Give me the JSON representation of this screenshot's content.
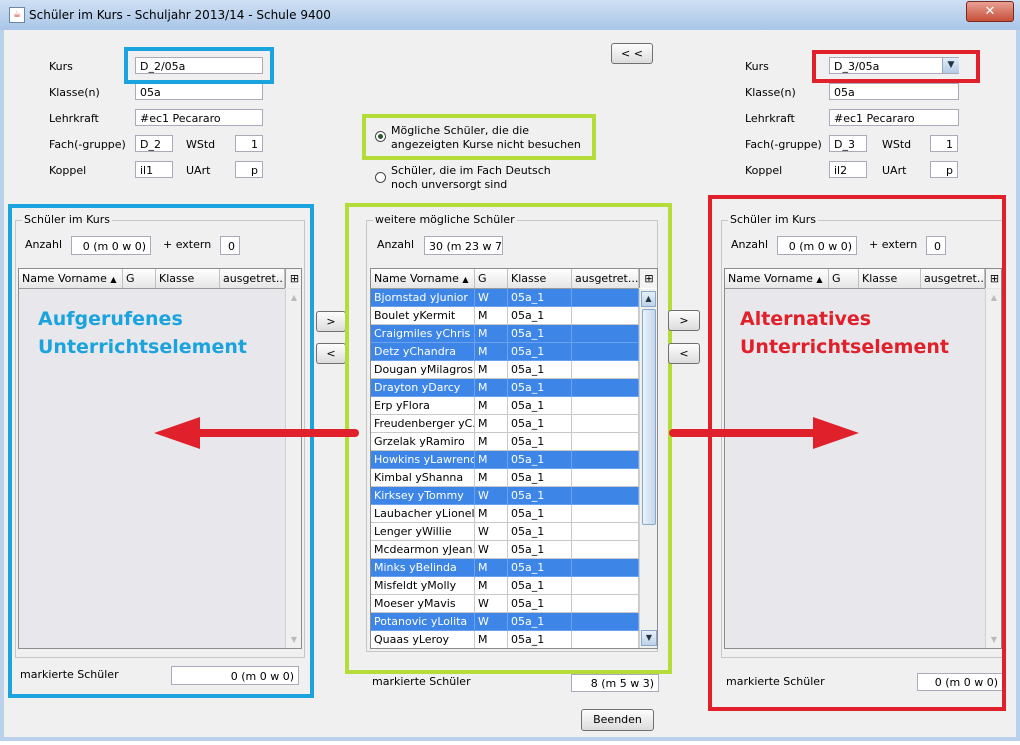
{
  "window": {
    "title": "Schüler im Kurs - Schuljahr 2013/14 - Schule 9400",
    "close_glyph": "✕"
  },
  "labels": {
    "kurs": "Kurs",
    "klassen": "Klasse(n)",
    "lehrkraft": "Lehrkraft",
    "fach": "Fach(-gruppe)",
    "wstd": "WStd",
    "koppel": "Koppel",
    "uart": "UArt",
    "schueler_im_kurs": "Schüler im Kurs",
    "anzahl": "Anzahl",
    "extern": "+  extern",
    "markierte": "markierte Schüler",
    "weitere": "weitere mögliche Schüler"
  },
  "left_course": {
    "kurs": "D_2/05a",
    "klassen": "05a",
    "lehrkraft": "#ec1 Pecararo",
    "fach": "D_2",
    "wstd": "1",
    "koppel": "il1",
    "uart": "p",
    "anzahl": "0 (m 0 w 0)",
    "extern": "0",
    "markierte": "0 (m 0 w 0)",
    "annotation_line1": "Aufgerufenes",
    "annotation_line2": "Unterrichtselement"
  },
  "right_course": {
    "kurs": "D_3/05a",
    "klassen": "05a",
    "lehrkraft": "#ec1 Pecararo",
    "fach": "D_3",
    "wstd": "1",
    "koppel": "il2",
    "uart": "p",
    "anzahl": "0 (m 0 w 0)",
    "extern": "0",
    "markierte": "0 (m 0 w 0)",
    "annotation_line1": "Alternatives",
    "annotation_line2": "Unterrichtselement"
  },
  "buttons": {
    "back": "< <",
    "move_right": ">",
    "move_left": "<",
    "beenden": "Beenden"
  },
  "filter": {
    "option1_line1": "Mögliche Schüler, die die",
    "option1_line2": "angezeigten Kurse nicht besuchen",
    "option2_line1": "Schüler, die im Fach Deutsch",
    "option2_line2": "noch unversorgt sind"
  },
  "columns": {
    "name": "Name Vorname",
    "g": "G",
    "klasse": "Klasse",
    "ausgetreten": "ausgetret..."
  },
  "middle": {
    "anzahl": "30 (m 23 w 7)",
    "markierte": "8 (m 5 w 3)",
    "rows": [
      {
        "name": "Bjornstad yJunior",
        "g": "W",
        "klasse": "05a_1",
        "sel": true
      },
      {
        "name": "Boulet yKermit",
        "g": "M",
        "klasse": "05a_1",
        "sel": false
      },
      {
        "name": "Craigmiles yChris",
        "g": "M",
        "klasse": "05a_1",
        "sel": true
      },
      {
        "name": "Detz yChandra",
        "g": "M",
        "klasse": "05a_1",
        "sel": true
      },
      {
        "name": "Dougan yMilagros",
        "g": "M",
        "klasse": "05a_1",
        "sel": false
      },
      {
        "name": "Drayton yDarcy",
        "g": "M",
        "klasse": "05a_1",
        "sel": true
      },
      {
        "name": "Erp yFlora",
        "g": "M",
        "klasse": "05a_1",
        "sel": false
      },
      {
        "name": "Freudenberger yC...",
        "g": "M",
        "klasse": "05a_1",
        "sel": false
      },
      {
        "name": "Grzelak yRamiro",
        "g": "M",
        "klasse": "05a_1",
        "sel": false
      },
      {
        "name": "Howkins yLawrence",
        "g": "M",
        "klasse": "05a_1",
        "sel": true
      },
      {
        "name": "Kimbal yShanna",
        "g": "M",
        "klasse": "05a_1",
        "sel": false
      },
      {
        "name": "Kirksey yTommy",
        "g": "W",
        "klasse": "05a_1",
        "sel": true
      },
      {
        "name": "Laubacher yLionel",
        "g": "M",
        "klasse": "05a_1",
        "sel": false
      },
      {
        "name": "Lenger yWillie",
        "g": "W",
        "klasse": "05a_1",
        "sel": false
      },
      {
        "name": "Mcdearmon yJean...",
        "g": "W",
        "klasse": "05a_1",
        "sel": false
      },
      {
        "name": "Minks yBelinda",
        "g": "M",
        "klasse": "05a_1",
        "sel": true
      },
      {
        "name": "Misfeldt yMolly",
        "g": "M",
        "klasse": "05a_1",
        "sel": false
      },
      {
        "name": "Moeser yMavis",
        "g": "W",
        "klasse": "05a_1",
        "sel": false
      },
      {
        "name": "Potanovic yLolita",
        "g": "W",
        "klasse": "05a_1",
        "sel": true
      },
      {
        "name": "Quaas yLeroy",
        "g": "M",
        "klasse": "05a_1",
        "sel": false
      }
    ]
  },
  "colors": {
    "blue": "#1aa3dc",
    "green": "#b5dd3a",
    "red": "#e0202a",
    "selection": "#3d85e7"
  }
}
